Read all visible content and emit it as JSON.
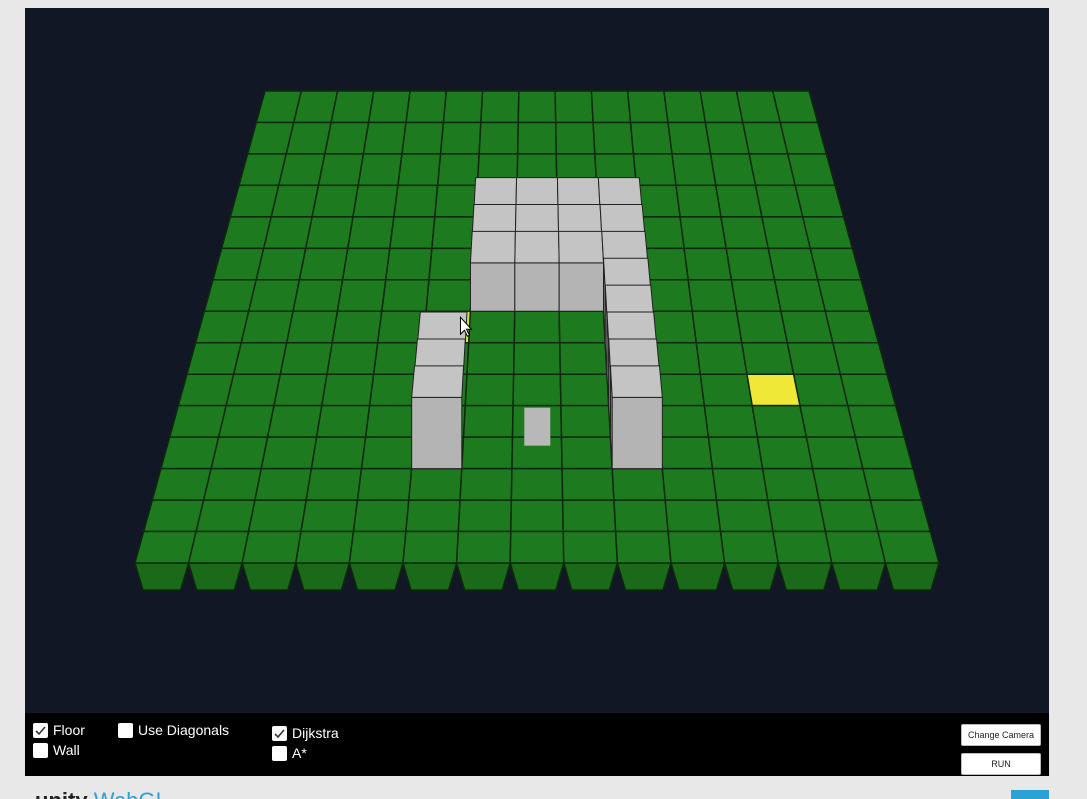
{
  "toolbar": {
    "floor": {
      "label": "Floor",
      "checked": true
    },
    "wall": {
      "label": "Wall",
      "checked": false
    },
    "diagonals": {
      "label": "Use Diagonals",
      "checked": false
    },
    "dijkstra": {
      "label": "Dijkstra",
      "checked": true
    },
    "astar": {
      "label": "A*",
      "checked": false
    },
    "change_camera_label": "Change Camera",
    "run_label": "RUN"
  },
  "grid": {
    "cols": 15,
    "rows": 15,
    "floor_color": "#1e7a1e",
    "wall_color": "#b2b2b2",
    "start_color": "#c9e33f",
    "goal_color": "#f0e836",
    "background_color": "#111724",
    "start_cell": {
      "col": 5,
      "row": 7
    },
    "goal_cell": {
      "col": 12,
      "row": 9
    },
    "wall_cells": [
      [
        6,
        4
      ],
      [
        7,
        4
      ],
      [
        8,
        4
      ],
      [
        9,
        4
      ],
      [
        6,
        5
      ],
      [
        7,
        5
      ],
      [
        8,
        5
      ],
      [
        9,
        5
      ],
      [
        6,
        6
      ],
      [
        7,
        6
      ],
      [
        8,
        6
      ],
      [
        9,
        6
      ],
      [
        9,
        7
      ],
      [
        9,
        8
      ],
      [
        9,
        9
      ],
      [
        5,
        9
      ],
      [
        5,
        10
      ],
      [
        5,
        11
      ],
      [
        9,
        10
      ],
      [
        9,
        11
      ]
    ],
    "agent_cell": {
      "col": 7,
      "row": 10
    }
  },
  "footer": {
    "brand_main": "unity",
    "brand_accent": "WebGL"
  }
}
